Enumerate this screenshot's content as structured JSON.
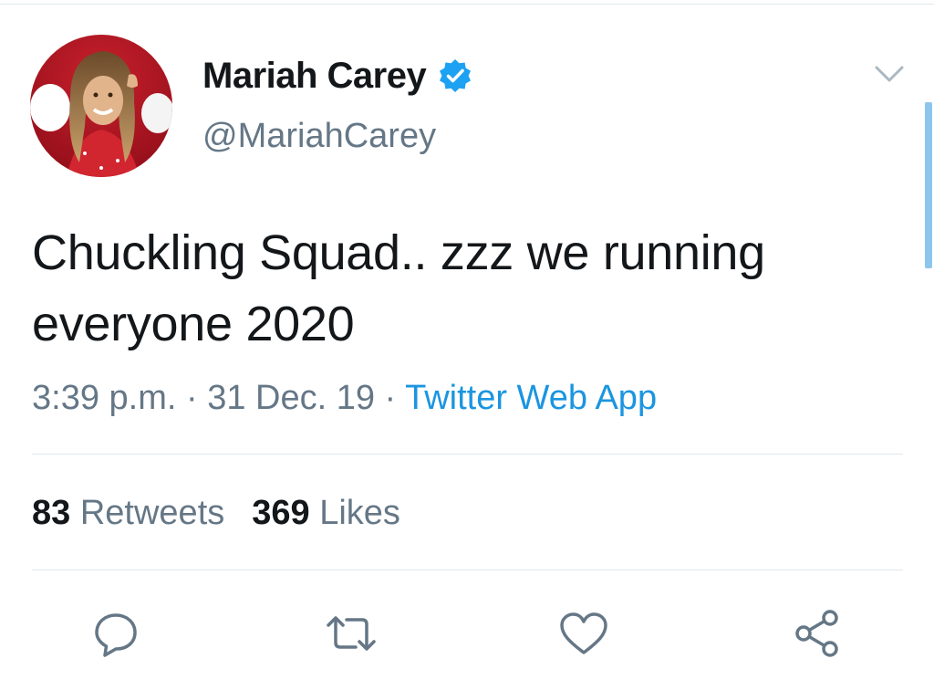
{
  "tweet": {
    "author": {
      "display_name": "Mariah Carey",
      "handle": "@MariahCarey",
      "verified": true
    },
    "text_line1": "Chuckling Squad.. zzz we running",
    "text_line2": "everyone 2020",
    "time": "3:39 p.m.",
    "separator": " · ",
    "date": "31 Dec. 19",
    "source": "Twitter Web App",
    "retweets_count": "83",
    "retweets_label": "Retweets",
    "likes_count": "369",
    "likes_label": "Likes"
  },
  "icons": {
    "verified": "verified-badge-icon",
    "menu": "chevron-down-icon",
    "reply": "reply-icon",
    "retweet": "retweet-icon",
    "like": "heart-icon",
    "share": "share-icon"
  },
  "colors": {
    "accent": "#1b95e0",
    "text": "#14171a",
    "secondary": "#657786",
    "divider": "#e1e8ed",
    "verified": "#1da1f2"
  }
}
